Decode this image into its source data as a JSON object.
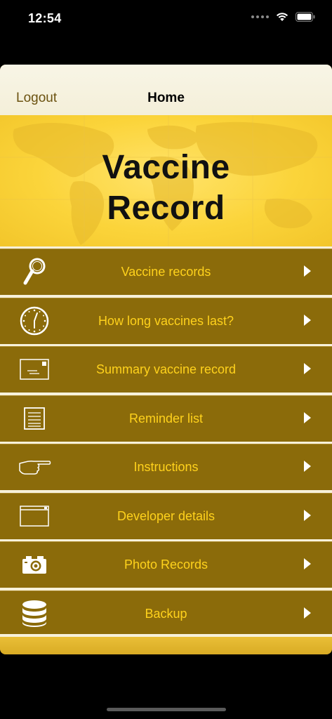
{
  "status_bar": {
    "time": "12:54",
    "icons": [
      "signal-dots-icon",
      "wifi-icon",
      "battery-icon"
    ]
  },
  "navbar": {
    "left_button": "Logout",
    "title": "Home"
  },
  "banner": {
    "line1": "Vaccine",
    "line2": "Record"
  },
  "menu": {
    "items": [
      {
        "label": "Vaccine records",
        "icon": "magnifier-icon"
      },
      {
        "label": "How long vaccines last?",
        "icon": "clock-icon"
      },
      {
        "label": "Summary vaccine record",
        "icon": "envelope-icon"
      },
      {
        "label": "Reminder list",
        "icon": "list-icon"
      },
      {
        "label": "Instructions",
        "icon": "pointing-hand-icon"
      },
      {
        "label": "Developer details",
        "icon": "window-icon"
      },
      {
        "label": "Photo Records",
        "icon": "camera-icon"
      },
      {
        "label": "Backup",
        "icon": "database-icon"
      }
    ]
  },
  "colors": {
    "row_background": "#8b6b0a",
    "row_text": "#ffd21c",
    "banner": "#fbd43a",
    "navbar": "#f6f2df"
  }
}
